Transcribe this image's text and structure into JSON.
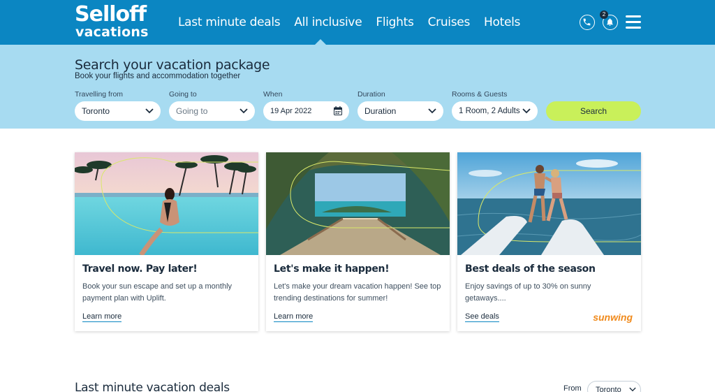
{
  "brand": {
    "logo_line1": "Selloff",
    "logo_line2": "vacations"
  },
  "nav": {
    "items": [
      "Last minute deals",
      "All inclusive",
      "Flights",
      "Cruises",
      "Hotels"
    ],
    "active": "All inclusive",
    "notification_count": "2",
    "icons": [
      "phone-icon",
      "bell-icon",
      "menu-icon"
    ]
  },
  "search": {
    "title": "Search your vacation package",
    "subtitle": "Book your flights and accommodation together",
    "fields": [
      {
        "label": "Travelling from",
        "value": "Toronto"
      },
      {
        "label": "Going to",
        "value": "Going to"
      },
      {
        "label": "When",
        "value": "19 Apr 2022"
      },
      {
        "label": "Duration",
        "value": "Duration"
      },
      {
        "label": "Rooms & Guests",
        "value": "1 Room, 2 Adults"
      }
    ],
    "button": "Search"
  },
  "cards": [
    {
      "title": "Travel now. Pay later!",
      "description": "Book your sun escape and set up a monthly payment plan with Uplift.",
      "link": "Learn more"
    },
    {
      "title": "Let's make it happen!",
      "description": "Let's make your dream vacation happen! See top trending destinations for summer!",
      "link": "Learn more"
    },
    {
      "title": "Best deals of the season",
      "description": "Enjoy savings of up to 30% on sunny getaways....",
      "link": "See deals",
      "brand": "sunwing"
    }
  ],
  "deals": {
    "title": "Last minute vacation deals",
    "from_label": "From",
    "from_value": "Toronto"
  },
  "colors": {
    "header": "#0b86c2",
    "search_band": "#a7dbf1",
    "search_button": "#c9f05a",
    "link_underline": "#0b86c2",
    "sunwing": "#f08a1c"
  }
}
